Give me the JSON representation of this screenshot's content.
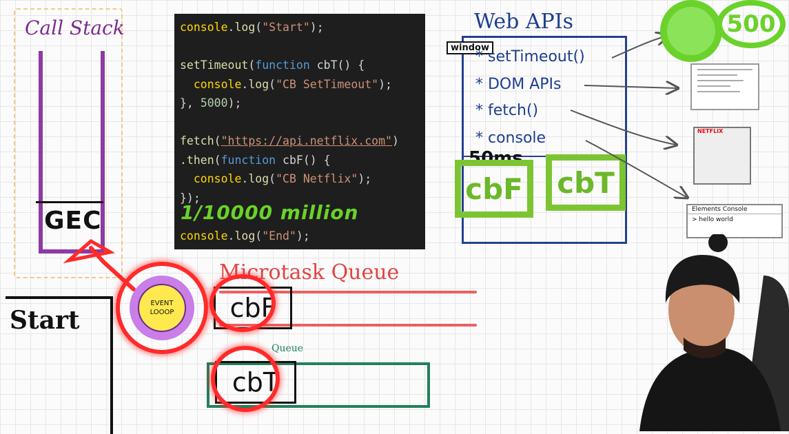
{
  "call_stack": {
    "title": "Call Stack",
    "frame": "GEC"
  },
  "code": {
    "lines": [
      [
        {
          "t": "console",
          "c": "pn"
        },
        {
          "t": ".",
          "c": ""
        },
        {
          "t": "log",
          "c": "fn"
        },
        {
          "t": "(",
          "c": ""
        },
        {
          "t": "\"Start\"",
          "c": "str"
        },
        {
          "t": ");",
          "c": ""
        }
      ],
      [],
      [
        {
          "t": "setTimeout",
          "c": "fn"
        },
        {
          "t": "(",
          "c": ""
        },
        {
          "t": "function",
          "c": "kw"
        },
        {
          "t": " cbT() {",
          "c": ""
        }
      ],
      [
        {
          "t": "  console",
          "c": "pn"
        },
        {
          "t": ".",
          "c": ""
        },
        {
          "t": "log",
          "c": "fn"
        },
        {
          "t": "(",
          "c": ""
        },
        {
          "t": "\"CB SetTimeout\"",
          "c": "str"
        },
        {
          "t": ");",
          "c": ""
        }
      ],
      [
        {
          "t": "}, ",
          "c": ""
        },
        {
          "t": "5000",
          "c": "num"
        },
        {
          "t": ");",
          "c": ""
        }
      ],
      [],
      [
        {
          "t": "fetch",
          "c": "fn"
        },
        {
          "t": "(",
          "c": ""
        },
        {
          "t": "\"https://api.netflix.com\"",
          "c": "url"
        },
        {
          "t": ")",
          "c": ""
        }
      ],
      [
        {
          "t": ".then",
          "c": "fn"
        },
        {
          "t": "(",
          "c": ""
        },
        {
          "t": "function",
          "c": "kw"
        },
        {
          "t": " cbF() {",
          "c": ""
        }
      ],
      [
        {
          "t": "  console",
          "c": "pn"
        },
        {
          "t": ".",
          "c": ""
        },
        {
          "t": "log",
          "c": "fn"
        },
        {
          "t": "(",
          "c": ""
        },
        {
          "t": "\"CB Netflix\"",
          "c": "str"
        },
        {
          "t": ");",
          "c": ""
        }
      ],
      [
        {
          "t": "});",
          "c": ""
        }
      ],
      [],
      [
        {
          "t": "console",
          "c": "pn"
        },
        {
          "t": ".",
          "c": ""
        },
        {
          "t": "log",
          "c": "fn"
        },
        {
          "t": "(",
          "c": ""
        },
        {
          "t": "\"End\"",
          "c": "str"
        },
        {
          "t": ");",
          "c": ""
        }
      ]
    ],
    "annotation": "1/10000 million"
  },
  "web_apis": {
    "title": "Web APIs",
    "window_tag": "window",
    "items": [
      "* setTimeout()",
      "* DOM APIs",
      "* fetch()",
      "* console"
    ],
    "timer_label": "50ms",
    "callbacks": [
      "cbF",
      "cbT"
    ]
  },
  "timer_badge": {
    "value": "500"
  },
  "thumbnails": {
    "netflix_brand": "NETFLIX",
    "devtools_tabs": "Elements  Console",
    "devtools_output": "> hello world"
  },
  "microtask_queue": {
    "title": "Microtask Queue",
    "item": "cbF"
  },
  "callback_queue": {
    "title": "Queue",
    "item": "cbT"
  },
  "event_loop": {
    "label_line1": "EVENT",
    "label_line2": "LOOOP"
  },
  "console_panel": {
    "output": "Start"
  },
  "colors": {
    "call_stack": "#8d3aa3",
    "web_apis": "#25408f",
    "callback_green": "#7bc532",
    "microtask_red": "#ef5f5f",
    "callback_queue_green": "#21805a",
    "highlight_red": "#ff2a2a",
    "event_loop_purple": "#c97ee8",
    "event_loop_yellow": "#ffe94f",
    "code_bg": "#1e1e1e"
  }
}
